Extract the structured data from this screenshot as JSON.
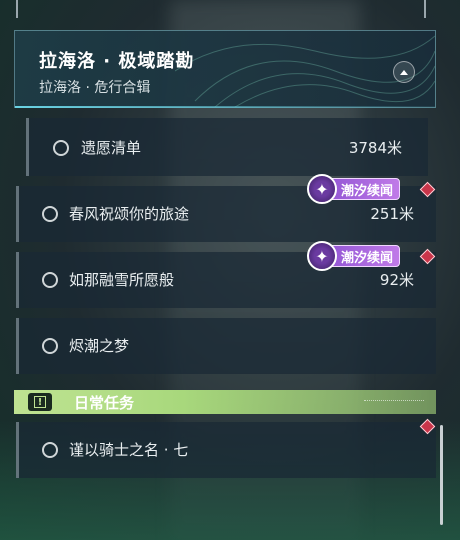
{
  "header": {
    "title": "拉海洛 · 极域踏勘",
    "subtitle": "拉海洛 · 危行合辑"
  },
  "quests": [
    {
      "name": "遗愿清单",
      "distance": "3784米",
      "tag": null
    },
    {
      "name": "春风祝颂你的旅途",
      "distance": "251米",
      "tag": "潮汐续闻"
    },
    {
      "name": "如那融雪所愿般",
      "distance": "92米",
      "tag": "潮汐续闻"
    },
    {
      "name": "烬潮之梦",
      "distance": "",
      "tag": null
    }
  ],
  "daily": {
    "section_label": "日常任务",
    "icon_glyph": "!",
    "quests": [
      {
        "name": "谨以骑士之名 · 七",
        "distance": ""
      }
    ]
  },
  "colors": {
    "tag_purple": "#a766dc",
    "daily_green": "#bfe392",
    "marker_red": "#c9354a"
  },
  "icons": {
    "tag_icon": "sparkle-icon",
    "collapse_icon": "chevron-up-icon",
    "daily_icon": "alert-icon",
    "marker_icon": "red-diamond-icon"
  }
}
